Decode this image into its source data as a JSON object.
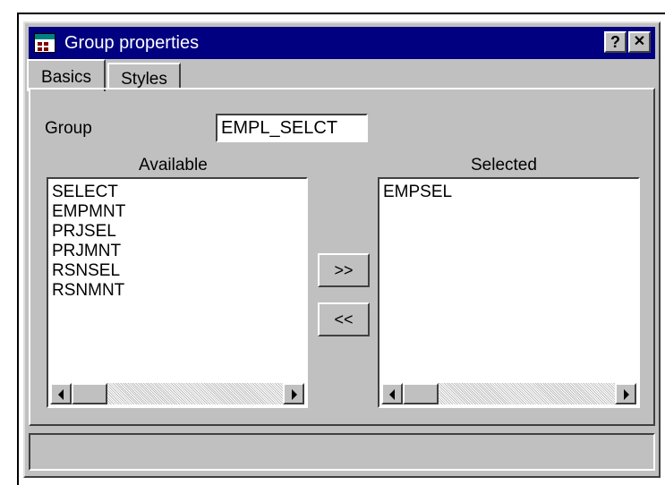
{
  "window": {
    "title": "Group properties",
    "help_label": "?",
    "close_label": "✕"
  },
  "tabs": [
    {
      "label": "Basics",
      "active": true
    },
    {
      "label": "Styles",
      "active": false
    }
  ],
  "group": {
    "label": "Group",
    "value": "EMPL_SELCT"
  },
  "available": {
    "label": "Available",
    "items": [
      "SELECT",
      "EMPMNT",
      "PRJSEL",
      "PRJMNT",
      "RSNSEL",
      "RSNMNT"
    ]
  },
  "selected": {
    "label": "Selected",
    "items": [
      "EMPSEL"
    ]
  },
  "buttons": {
    "add_label": ">>",
    "remove_label": "<<"
  },
  "status": {
    "text": ""
  },
  "colors": {
    "titlebar": "#000080",
    "face": "#c0c0c0"
  }
}
